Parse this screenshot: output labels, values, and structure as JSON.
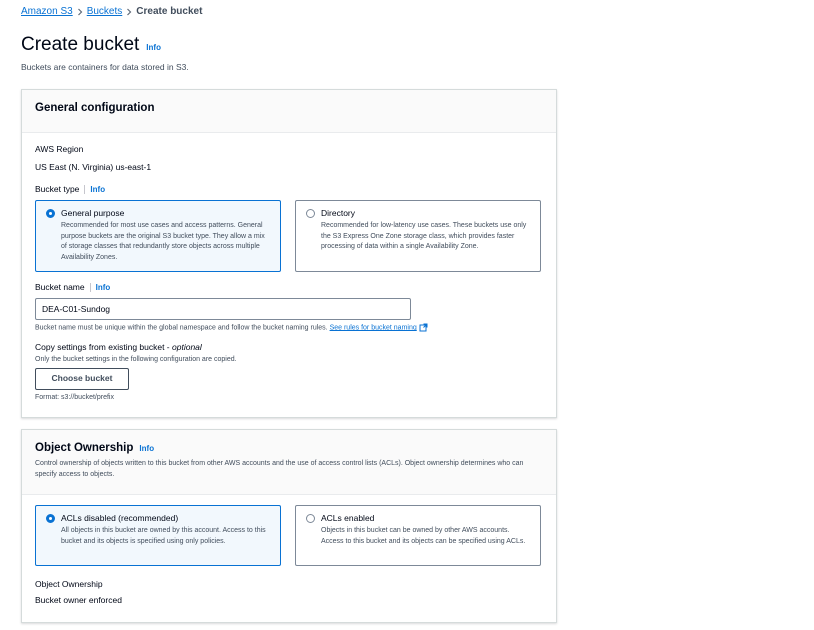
{
  "breadcrumb": {
    "items": [
      "Amazon S3",
      "Buckets"
    ],
    "current": "Create bucket"
  },
  "page": {
    "title": "Create bucket",
    "info": "Info",
    "description": "Buckets are containers for data stored in S3."
  },
  "general": {
    "title": "General configuration",
    "region_label": "AWS Region",
    "region_value": "US East (N. Virginia) us-east-1",
    "bucket_type_label": "Bucket type",
    "info": "Info",
    "types": [
      {
        "title": "General purpose",
        "desc": "Recommended for most use cases and access patterns. General purpose buckets are the original S3 bucket type. They allow a mix of storage classes that redundantly store objects across multiple Availability Zones.",
        "selected": true
      },
      {
        "title": "Directory",
        "desc": "Recommended for low-latency use cases. These buckets use only the S3 Express One Zone storage class, which provides faster processing of data within a single Availability Zone.",
        "selected": false
      }
    ],
    "bucket_name_label": "Bucket name",
    "bucket_name_value": "DEA-C01-Sundog",
    "bucket_name_hint": "Bucket name must be unique within the global namespace and follow the bucket naming rules.",
    "bucket_name_link": "See rules for bucket naming",
    "copy_label": "Copy settings from existing bucket - ",
    "copy_optional": "optional",
    "copy_hint": "Only the bucket settings in the following configuration are copied.",
    "choose_button": "Choose bucket",
    "format_hint": "Format: s3://bucket/prefix"
  },
  "ownership": {
    "title": "Object Ownership",
    "info": "Info",
    "description": "Control ownership of objects written to this bucket from other AWS accounts and the use of access control lists (ACLs). Object ownership determines who can specify access to objects.",
    "options": [
      {
        "title": "ACLs disabled (recommended)",
        "desc": "All objects in this bucket are owned by this account. Access to this bucket and its objects is specified using only policies.",
        "selected": true
      },
      {
        "title": "ACLs enabled",
        "desc": "Objects in this bucket can be owned by other AWS accounts. Access to this bucket and its objects can be specified using ACLs.",
        "selected": false
      }
    ],
    "ownership_label": "Object Ownership",
    "ownership_value": "Bucket owner enforced"
  },
  "colors": {
    "accent": "#0972d3",
    "selected_bg": "#f2f8fd",
    "text": "#000716"
  }
}
